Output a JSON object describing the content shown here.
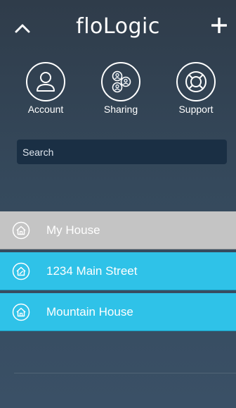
{
  "header": {
    "logo_text": "floLogic",
    "collapse_icon": "chevron-up-icon",
    "add_icon": "plus-icon"
  },
  "actions": [
    {
      "label": "Account",
      "icon": "person-icon"
    },
    {
      "label": "Sharing",
      "icon": "sharing-people-icon"
    },
    {
      "label": "Support",
      "icon": "lifebuoy-icon"
    }
  ],
  "search": {
    "placeholder": "Search",
    "value": ""
  },
  "houses": [
    {
      "label": "My House",
      "icon": "house-icon",
      "state": "gray"
    },
    {
      "label": "1234 Main Street",
      "icon": "house-alert-icon",
      "state": "selected"
    },
    {
      "label": "Mountain House",
      "icon": "house-icon",
      "state": "selected"
    }
  ],
  "colors": {
    "background_top": "#2f3c4a",
    "background_bottom": "#3a5066",
    "accent_blue": "#2fc2e8",
    "inactive_gray": "#c4c4c4",
    "search_bg": "#1a2f44"
  }
}
